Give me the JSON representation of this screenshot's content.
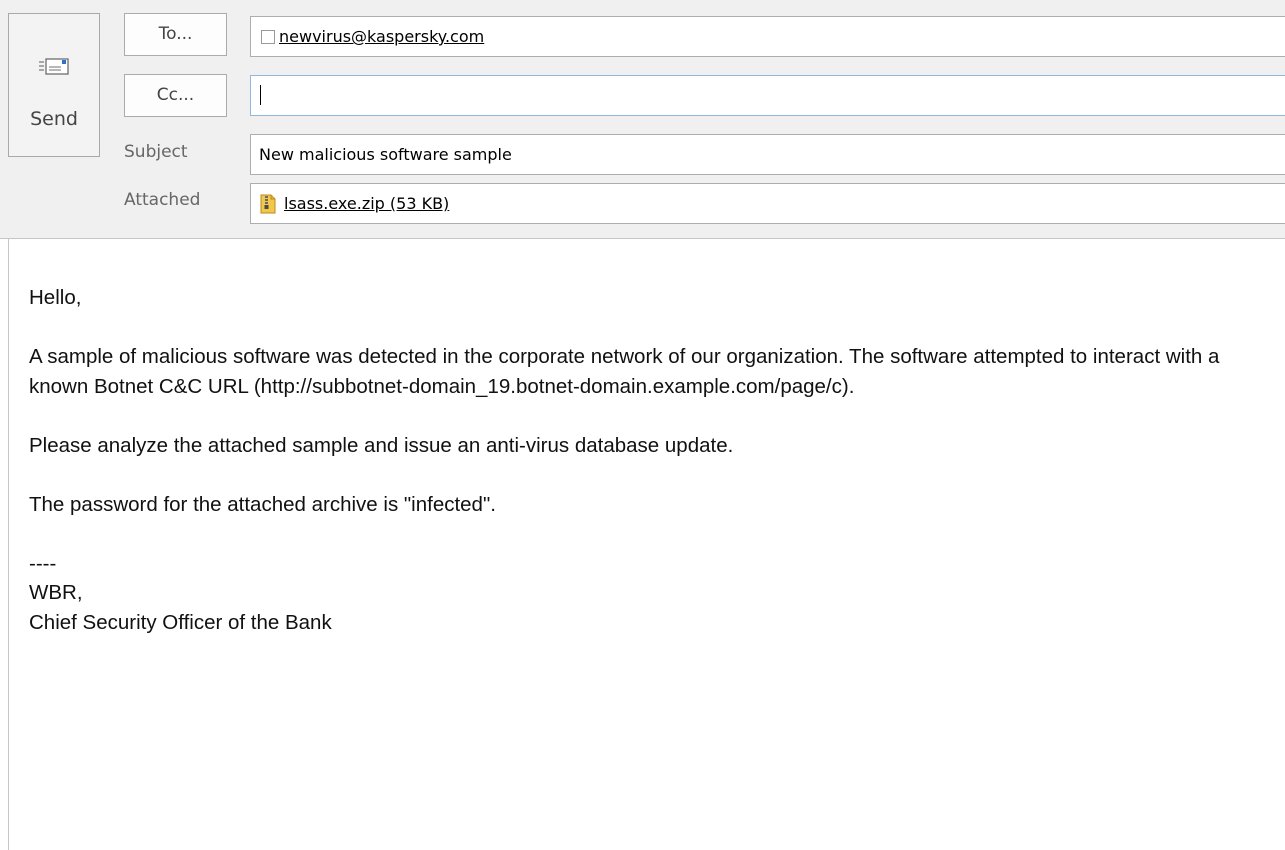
{
  "header": {
    "send_label": "Send",
    "to_button": "To...",
    "cc_button": "Cc...",
    "subject_label": "Subject",
    "attached_label": "Attached"
  },
  "fields": {
    "to_recipient": "newvirus@kaspersky.com",
    "cc_value": "",
    "subject": "New malicious software sample",
    "attachment": "lsass.exe.zip (53 KB)"
  },
  "body": {
    "greeting": "Hello,",
    "paragraph1": "A sample of malicious software was detected in the corporate network of our organization. The software attempted to interact with a known Botnet C&C URL (http://subbotnet-domain_19.botnet-domain.example.com/page/c).",
    "paragraph2": "Please analyze the attached sample and issue an anti-virus database update.",
    "paragraph3": "The password for the attached archive is \"infected\".",
    "separator": "----",
    "sign_off": "WBR,",
    "signature": "Chief Security Officer of the Bank"
  },
  "icons": {
    "send": "send-icon",
    "attachment": "zip-archive-icon"
  },
  "colors": {
    "header_bg": "#f0f0f0",
    "cc_focus_border": "#8fb8dc"
  }
}
